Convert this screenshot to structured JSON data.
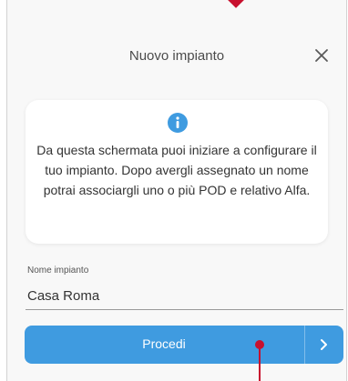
{
  "header": {
    "title": "Nuovo impianto",
    "close_icon": "close-icon"
  },
  "info_card": {
    "icon": "info-icon",
    "text": "Da questa schermata puoi iniziare a configurare il tuo impianto. Dopo avergli assegnato un nome potrai associargli uno o più POD e relativo Alfa."
  },
  "form": {
    "name_label": "Nome impianto",
    "name_value": "Casa Roma"
  },
  "actions": {
    "proceed_label": "Procedi",
    "proceed_arrow_icon": "chevron-right-icon"
  },
  "colors": {
    "accent": "#3f9be0",
    "annotation": "#c8102e",
    "background": "#f8f8f8"
  }
}
